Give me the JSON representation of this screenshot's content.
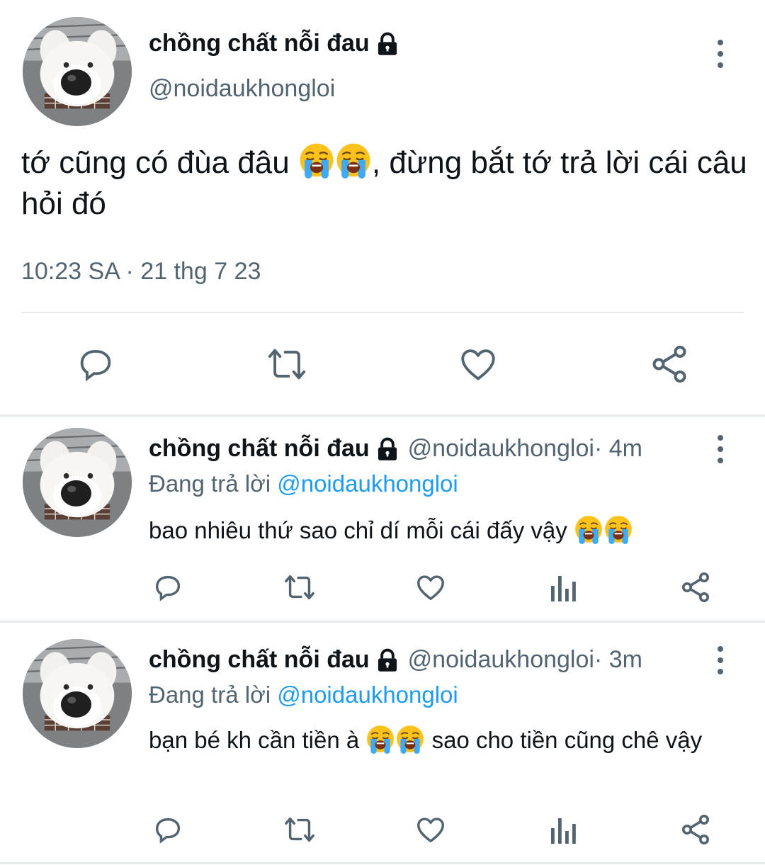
{
  "main_tweet": {
    "display_name": "chồng chất nỗi đau",
    "handle": "@noidaukhongloi",
    "text_part1": "tớ cũng có đùa đâu ",
    "text_part2": ", đừng bắt tớ trả lời cái câu hỏi đó",
    "timestamp": "10:23 SA · 21 thg 7 23",
    "lock_icon": "lock-icon",
    "emoji": "loudly-crying-face-emoji"
  },
  "replies": [
    {
      "display_name": "chồng chất nỗi đau",
      "handle": "@noidaukhongloi",
      "time": " · 4m",
      "replying_label": "Đang trả lời ",
      "replying_to": "@noidaukhongloi",
      "text_part1": "bao nhiêu thứ sao chỉ dí mỗi cái đấy vậy ",
      "text_part2": ""
    },
    {
      "display_name": "chồng chất nỗi đau",
      "handle": "@noidaukhongloi",
      "time": " · 3m",
      "replying_label": "Đang trả lời ",
      "replying_to": "@noidaukhongloi",
      "text_part1": "bạn bé kh cần tiền à ",
      "text_part2": " sao cho tiền cũng chê vậy"
    }
  ],
  "colors": {
    "text": "#0f1419",
    "secondary": "#536471",
    "link": "#1d9bf0",
    "divider": "#e6e9eb"
  }
}
